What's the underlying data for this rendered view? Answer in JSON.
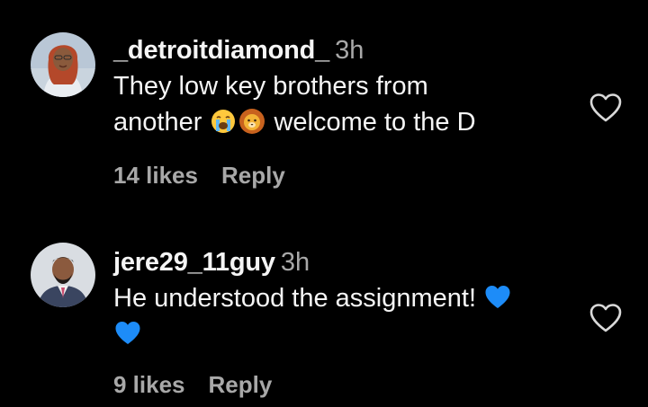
{
  "comments": [
    {
      "username": "_detroitdiamond_",
      "time": "3h",
      "text_line1": "They low key brothers from",
      "text_line2_before": "another",
      "text_line2_after": "welcome to the D",
      "emojis": [
        "crying-face-emoji",
        "lion-face-emoji"
      ],
      "likes": "14 likes",
      "reply": "Reply",
      "avatar": "woman-red-hair-avatar"
    },
    {
      "username": "jere29_11guy",
      "time": "3h",
      "text_line1": "He understood the assignment!",
      "emojis": [
        "blue-heart-emoji",
        "blue-heart-emoji"
      ],
      "likes": "9 likes",
      "reply": "Reply",
      "avatar": "man-suit-avatar"
    }
  ],
  "colors": {
    "background": "#000000",
    "primary_text": "#f5f5f5",
    "secondary_text": "#a8a8a8",
    "blue_heart": "#1d8cf8"
  }
}
